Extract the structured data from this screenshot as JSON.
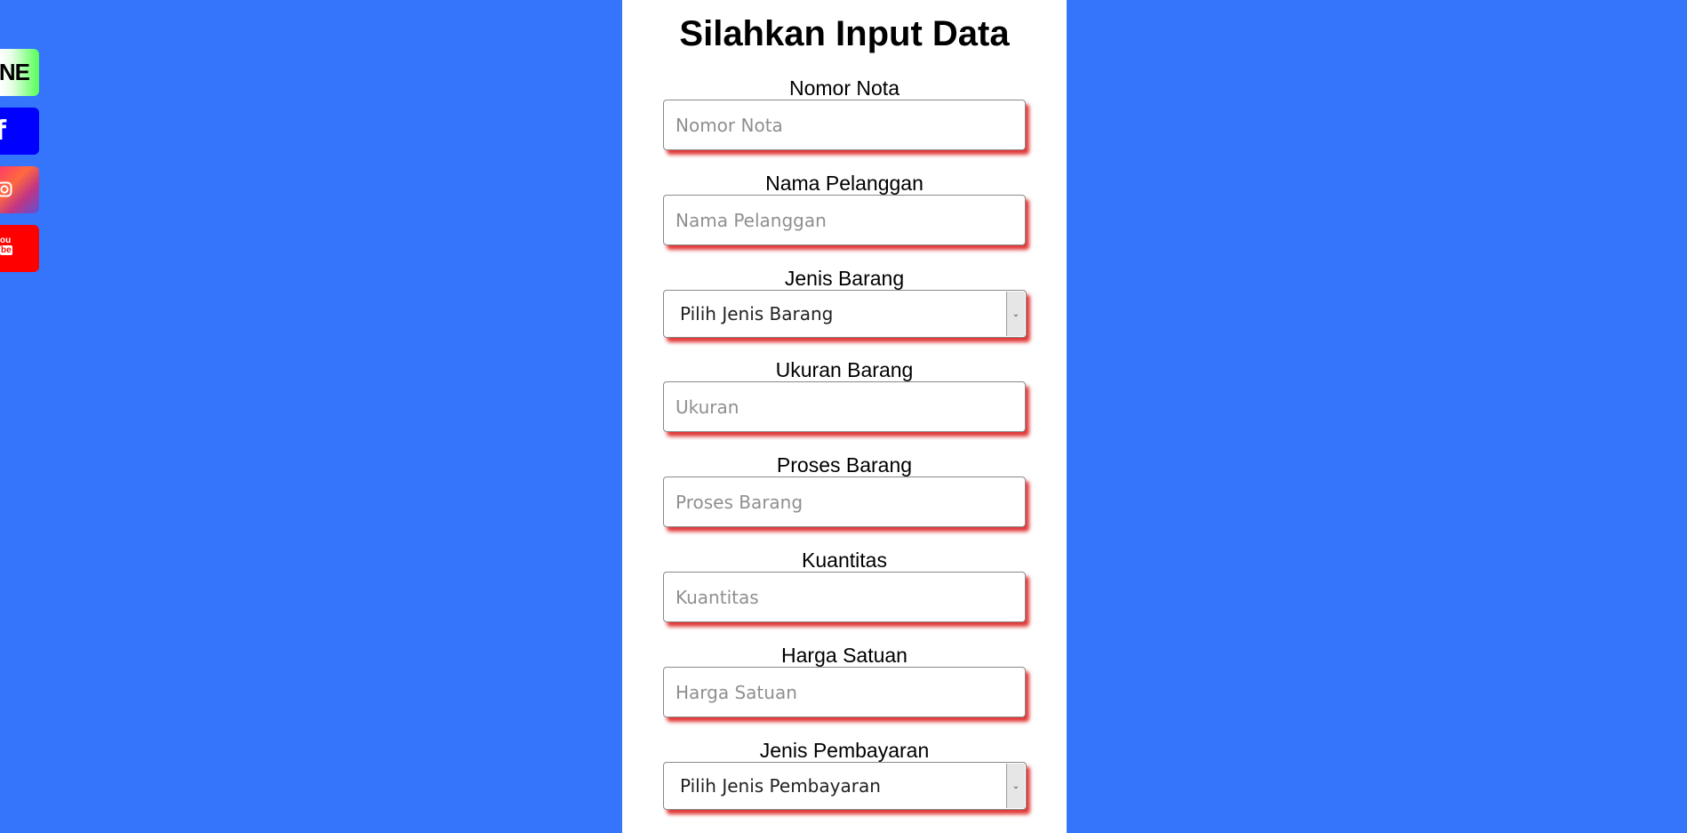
{
  "social": {
    "line_label": "NE",
    "facebook_label": "f",
    "youtube_label_top": "ou",
    "youtube_label_bottom": "be"
  },
  "form": {
    "title": "Silahkan Input Data",
    "fields": [
      {
        "label": "Nomor Nota",
        "placeholder": "Nomor Nota"
      },
      {
        "label": "Nama Pelanggan",
        "placeholder": "Nama Pelanggan"
      },
      {
        "label": "Jenis Barang",
        "selected": "Pilih Jenis Barang"
      },
      {
        "label": "Ukuran Barang",
        "placeholder": "Ukuran"
      },
      {
        "label": "Proses Barang",
        "placeholder": "Proses Barang"
      },
      {
        "label": "Kuantitas",
        "placeholder": "Kuantitas"
      },
      {
        "label": "Harga Satuan",
        "placeholder": "Harga Satuan"
      },
      {
        "label": "Jenis Pembayaran",
        "selected": "Pilih Jenis Pembayaran"
      }
    ]
  },
  "colors": {
    "background": "#3575fc",
    "panel": "#ffffff",
    "shadow": "#dc1414"
  }
}
